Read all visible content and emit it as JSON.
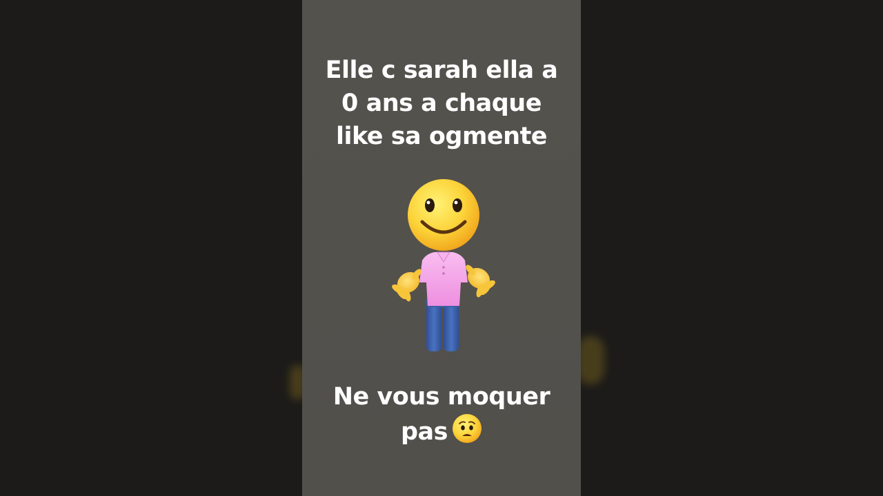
{
  "caption_top": {
    "line1": "Elle c sarah ella a",
    "line2": "0 ans a chaque",
    "line3": "like sa ogmente"
  },
  "caption_bottom": {
    "line1": "Ne vous moquer",
    "line2": "pas"
  },
  "icons": {
    "face": "slightly-smiling-face-icon",
    "shirt": "pink-polo-shirt-icon",
    "hands": "open-hands-icon",
    "jeans": "blue-jeans-icon",
    "worried": "worried-face-icon"
  },
  "colors": {
    "panel_bg": "#53514c",
    "sidebar_bg": "#1c1b19",
    "text": "#ffffff",
    "shirt": "#f4a6e8",
    "jeans": "#3b5fa8",
    "face": "#fcd43a"
  }
}
